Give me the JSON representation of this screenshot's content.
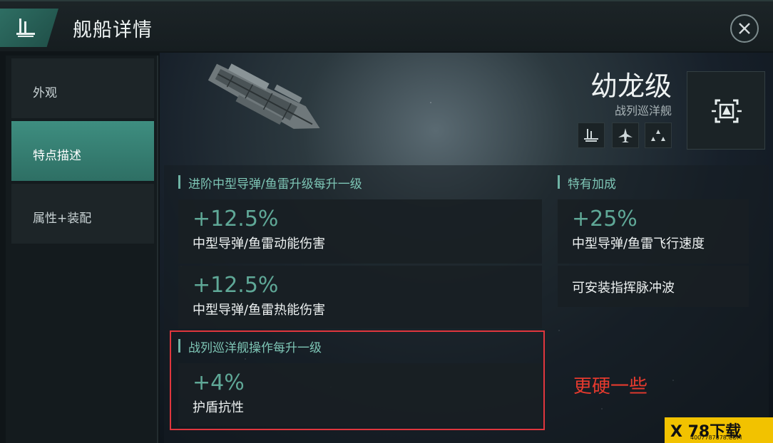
{
  "header": {
    "title": "舰船详情"
  },
  "sidebar": {
    "items": [
      {
        "label": "外观",
        "active": false
      },
      {
        "label": "特点描述",
        "active": true
      },
      {
        "label": "属性+装配",
        "active": false
      }
    ]
  },
  "ship": {
    "name": "幼龙级",
    "class": "战列巡洋舰",
    "role_icons": [
      "fleet-icon",
      "fighter-icon",
      "formation-icon"
    ]
  },
  "bonuses": {
    "section1": {
      "title": "进阶中型导弹/鱼雷升级每升一级",
      "items": [
        {
          "value": "+12.5%",
          "desc": "中型导弹/鱼雷动能伤害"
        },
        {
          "value": "+12.5%",
          "desc": "中型导弹/鱼雷热能伤害"
        }
      ]
    },
    "section2": {
      "title": "特有加成",
      "items": [
        {
          "value": "+25%",
          "desc": "中型导弹/鱼雷飞行速度"
        }
      ],
      "extra": "可安装指挥脉冲波"
    },
    "section3": {
      "title": "战列巡洋舰操作每升一级",
      "items": [
        {
          "value": "+4%",
          "desc": "护盾抗性"
        }
      ]
    }
  },
  "annotation": "更硬一些",
  "watermark": {
    "main": "X 78下载",
    "sub": "4007787878.COM"
  },
  "colors": {
    "accent": "#3e8e80",
    "bonus_value": "#5fa897",
    "highlight": "#e0363d"
  }
}
